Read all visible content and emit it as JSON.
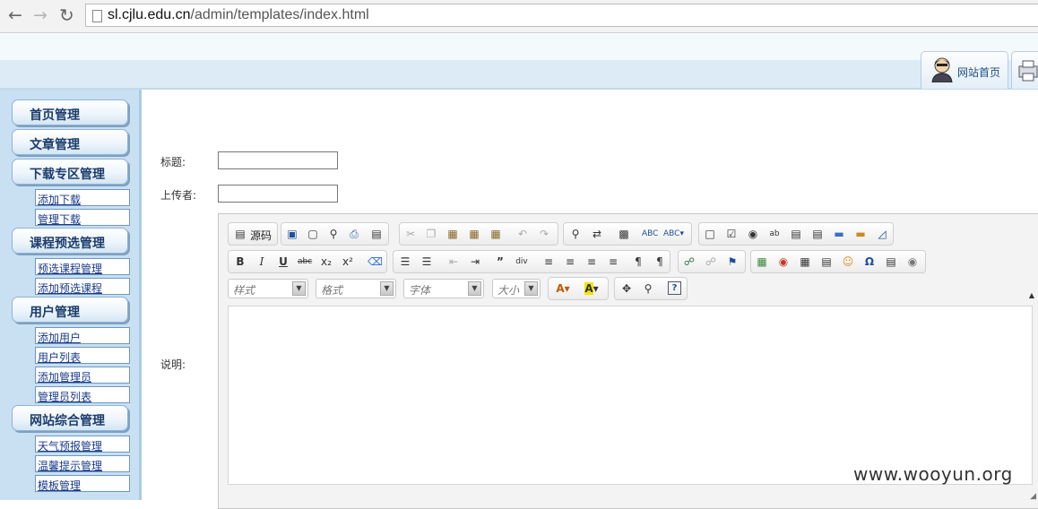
{
  "browser": {
    "url_host": "sl.cjlu.edu.cn",
    "url_path": "/admin/templates/index.html"
  },
  "header": {
    "home_tab_label": "网站首页"
  },
  "sidebar": {
    "sections": [
      {
        "label": "首页管理",
        "items": []
      },
      {
        "label": "文章管理",
        "items": []
      },
      {
        "label": "下载专区管理",
        "items": [
          "添加下载",
          "管理下载"
        ]
      },
      {
        "label": "课程预选管理",
        "items": [
          "预选课程管理",
          "添加预选课程"
        ]
      },
      {
        "label": "用户管理",
        "items": [
          "添加用户",
          "用户列表",
          "添加管理员",
          "管理员列表"
        ]
      },
      {
        "label": "网站综合管理",
        "items": [
          "天气预报管理",
          "温馨提示管理",
          "模板管理"
        ]
      }
    ]
  },
  "form": {
    "title_label": "标题:",
    "title_value": "",
    "uploader_label": "上传者:",
    "uploader_value": "",
    "desc_label": "说明:"
  },
  "editor": {
    "source_label": "源码",
    "style_placeholder": "样式",
    "format_placeholder": "格式",
    "font_placeholder": "字体",
    "size_placeholder": "大小"
  },
  "watermark": "www.wooyun.org"
}
